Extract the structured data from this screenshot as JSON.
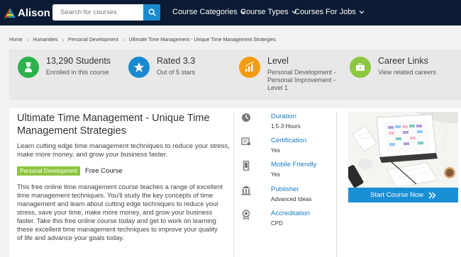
{
  "header": {
    "logo_text": "Alison",
    "search_placeholder": "Search for courses",
    "nav": [
      "Course Categories",
      "Course Types",
      "Courses For Jobs"
    ]
  },
  "breadcrumb": [
    "Home",
    "Humanities",
    "Personal Development",
    "Ultimate Time Management - Unique Time Management Strategies"
  ],
  "stats": [
    {
      "title": "13,290 Students",
      "sub": "Enrolled in this course",
      "color": "#2bb24c",
      "icon": "student-icon"
    },
    {
      "title": "Rated 3.3",
      "sub": "Out of 5 stars",
      "color": "#1a8ad0",
      "icon": "star-icon"
    },
    {
      "title": "Level",
      "sub": "Personal Development - Personal Improvement - Level 1",
      "color": "#f39c12",
      "icon": "level-chart-icon"
    },
    {
      "title": "Career Links",
      "sub": "View related careers",
      "color": "#8dc63f",
      "icon": "briefcase-icon"
    }
  ],
  "course": {
    "title": "Ultimate Time Management - Unique Time Management Strategies",
    "short_desc": "Learn cutting edge time management techniques to reduce your stress, make more money, and grow your business faster.",
    "tag": "Personal Development",
    "type": "Free Course",
    "long_desc": "This free online time management course teaches a range of excellent time management techniques. You'll study the key concepts of time management and learn about cutting edge techniques to reduce your stress, save your time, make more money, and grow your business faster. Take this free online course today and get to work on learning these excellent time management techniques to improve your quality of life and advance your goals today."
  },
  "info": [
    {
      "label": "Duration",
      "value": "1.5-3 Hours",
      "icon": "clock-icon"
    },
    {
      "label": "Certification",
      "value": "Yes",
      "icon": "certificate-icon"
    },
    {
      "label": "Mobile Friendly",
      "value": "Yes",
      "icon": "mobile-icon"
    },
    {
      "label": "Publisher",
      "value": "Advanced Ideas",
      "icon": "publisher-icon"
    },
    {
      "label": "Accreditation",
      "value": "CPD",
      "icon": "accreditation-icon"
    }
  ],
  "cta": {
    "label": "Start Course Now"
  }
}
